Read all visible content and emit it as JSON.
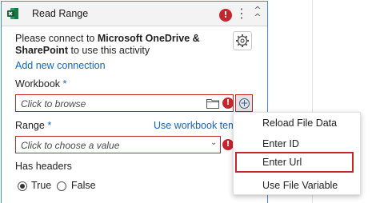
{
  "header": {
    "title": "Read Range",
    "error_mark": "!",
    "menu_glyph": "⋮",
    "collapse_glyph": "︽"
  },
  "connect": {
    "prefix": "Please connect to ",
    "product1": "Microsoft OneDrive &",
    "product2": "SharePoint",
    "suffix": " to use this activity",
    "add_link": "Add new connection"
  },
  "workbook": {
    "label": "Workbook",
    "required_mark": "*",
    "placeholder": "Click to browse",
    "error_mark": "!",
    "plus": "+"
  },
  "range": {
    "label": "Range",
    "required_mark": "*",
    "link": "Use workbook temp",
    "placeholder": "Click to choose a value",
    "error_mark": "!",
    "chevron": "⌄"
  },
  "has_headers": {
    "label": "Has headers",
    "options": [
      "True",
      "False"
    ],
    "selected": "True"
  },
  "menu": {
    "items": [
      "Reload File Data",
      "Enter ID",
      "Enter Url",
      "Use File Variable"
    ],
    "highlighted": "Enter Url"
  }
}
